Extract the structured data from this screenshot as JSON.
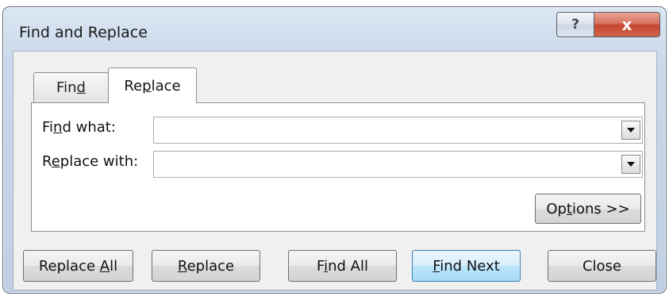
{
  "window": {
    "title": "Find and Replace",
    "help_glyph": "?",
    "close_glyph": "x"
  },
  "tabs": [
    {
      "pre": "Fin",
      "accel": "d",
      "post": "",
      "selected": false
    },
    {
      "pre": "Re",
      "accel": "p",
      "post": "lace",
      "selected": true
    }
  ],
  "fields": {
    "find_what": {
      "pre": "Fi",
      "accel": "n",
      "post": "d what:",
      "value": ""
    },
    "replace_with": {
      "pre": "R",
      "accel": "e",
      "post": "place with:",
      "value": ""
    }
  },
  "options_button": {
    "pre": "Op",
    "accel": "t",
    "post": "ions >>"
  },
  "buttons": {
    "replace_all": {
      "pre": "Replace ",
      "accel": "A",
      "post": "ll"
    },
    "replace": {
      "pre": "",
      "accel": "R",
      "post": "eplace"
    },
    "find_all": {
      "pre": "F",
      "accel": "i",
      "post": "nd All"
    },
    "find_next": {
      "pre": "",
      "accel": "F",
      "post": "ind Next"
    },
    "close": {
      "pre": "Close",
      "accel": "",
      "post": ""
    }
  },
  "colors": {
    "default_button_border": "#3c7fb1",
    "close_caption_button": "#c4452d"
  }
}
